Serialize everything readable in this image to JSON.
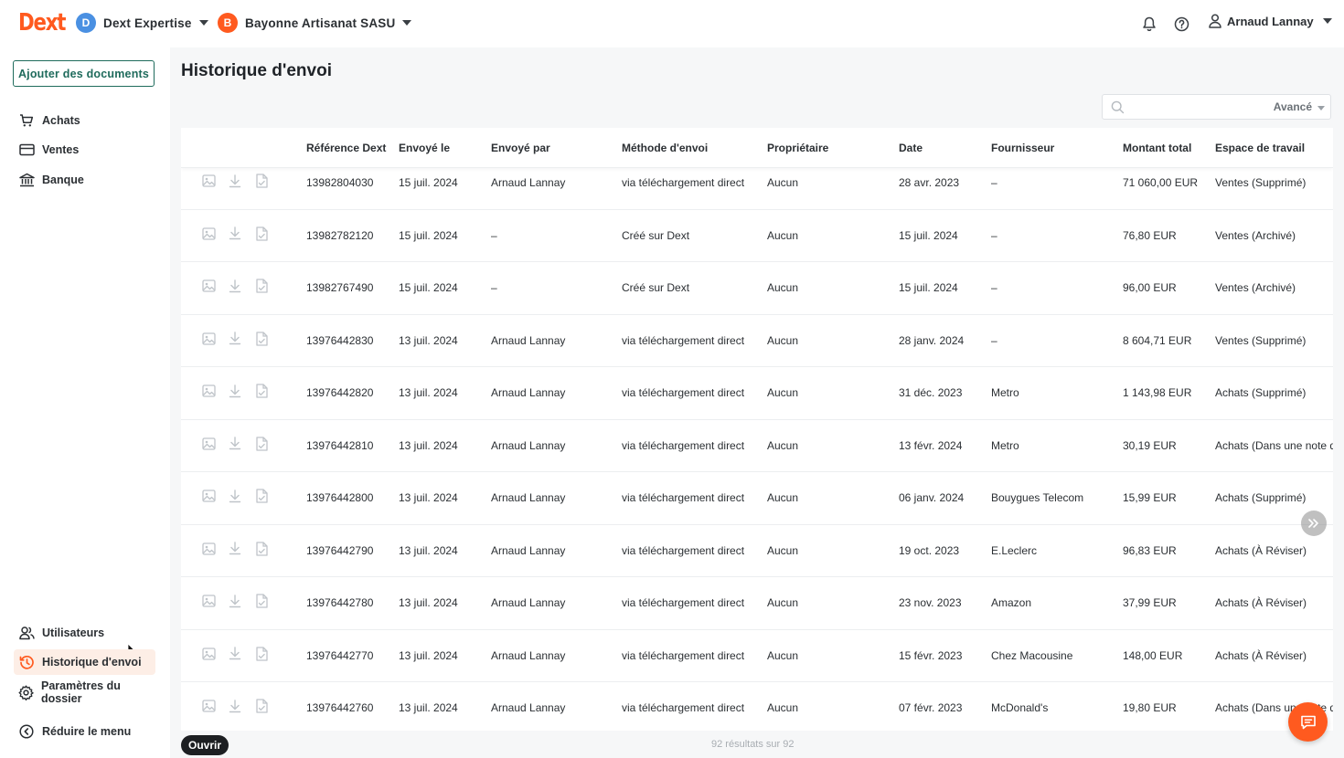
{
  "brand": {
    "logo_text": "Dext",
    "accent": "#ff5a1f"
  },
  "header": {
    "practice": {
      "initial": "D",
      "name": "Dext Expertise",
      "color": "#4a90e2"
    },
    "client": {
      "initial": "B",
      "name": "Bayonne Artisanat SASU",
      "color": "#ff5a1f"
    },
    "user_name": "Arnaud Lannay",
    "icons": [
      "bell-icon",
      "help-icon",
      "user-icon"
    ]
  },
  "sidebar": {
    "add_button": "Ajouter des documents",
    "top_items": [
      {
        "label": "Achats",
        "icon": "cart-icon"
      },
      {
        "label": "Ventes",
        "icon": "card-icon"
      },
      {
        "label": "Banque",
        "icon": "bank-icon"
      }
    ],
    "bottom_items": [
      {
        "label": "Utilisateurs",
        "icon": "users-icon"
      },
      {
        "label": "Historique d'envoi",
        "icon": "history-icon",
        "active": true
      },
      {
        "label": "Paramètres du dossier",
        "icon": "gear-icon"
      },
      {
        "label": "Réduire le menu",
        "icon": "collapse-icon"
      }
    ]
  },
  "main": {
    "title": "Historique d'envoi",
    "search": {
      "placeholder": "",
      "advanced_label": "Avancé"
    },
    "columns": [
      "Référence Dext",
      "Envoyé le",
      "Envoyé par",
      "Méthode d'envoi",
      "Propriétaire",
      "Date",
      "Fournisseur",
      "Montant total",
      "Espace de travail"
    ],
    "rows": [
      [
        "13982804030",
        "15 juil. 2024",
        "Arnaud Lannay",
        "via téléchargement direct",
        "Aucun",
        "28 avr. 2023",
        "–",
        "71 060,00 EUR",
        "Ventes (Supprimé)"
      ],
      [
        "13982782120",
        "15 juil. 2024",
        "–",
        "Créé sur Dext",
        "Aucun",
        "15 juil. 2024",
        "–",
        "76,80 EUR",
        "Ventes (Archivé)"
      ],
      [
        "13982767490",
        "15 juil. 2024",
        "–",
        "Créé sur Dext",
        "Aucun",
        "15 juil. 2024",
        "–",
        "96,00 EUR",
        "Ventes (Archivé)"
      ],
      [
        "13976442830",
        "13 juil. 2024",
        "Arnaud Lannay",
        "via téléchargement direct",
        "Aucun",
        "28 janv. 2024",
        "–",
        "8 604,71 EUR",
        "Ventes (Supprimé)"
      ],
      [
        "13976442820",
        "13 juil. 2024",
        "Arnaud Lannay",
        "via téléchargement direct",
        "Aucun",
        "31 déc. 2023",
        "Metro",
        "1 143,98 EUR",
        "Achats (Supprimé)"
      ],
      [
        "13976442810",
        "13 juil. 2024",
        "Arnaud Lannay",
        "via téléchargement direct",
        "Aucun",
        "13 févr. 2024",
        "Metro",
        "30,19 EUR",
        "Achats (Dans une note d"
      ],
      [
        "13976442800",
        "13 juil. 2024",
        "Arnaud Lannay",
        "via téléchargement direct",
        "Aucun",
        "06 janv. 2024",
        "Bouygues Telecom",
        "15,99 EUR",
        "Achats (Supprimé)"
      ],
      [
        "13976442790",
        "13 juil. 2024",
        "Arnaud Lannay",
        "via téléchargement direct",
        "Aucun",
        "19 oct. 2023",
        "E.Leclerc",
        "96,83 EUR",
        "Achats (À Réviser)"
      ],
      [
        "13976442780",
        "13 juil. 2024",
        "Arnaud Lannay",
        "via téléchargement direct",
        "Aucun",
        "23 nov. 2023",
        "Amazon",
        "37,99 EUR",
        "Achats (À Réviser)"
      ],
      [
        "13976442770",
        "13 juil. 2024",
        "Arnaud Lannay",
        "via téléchargement direct",
        "Aucun",
        "15 févr. 2023",
        "Chez Macousine",
        "148,00 EUR",
        "Achats (À Réviser)"
      ],
      [
        "13976442760",
        "13 juil. 2024",
        "Arnaud Lannay",
        "via téléchargement direct",
        "Aucun",
        "07 févr. 2023",
        "McDonald's",
        "19,80 EUR",
        "Achats (Dans une note d"
      ]
    ],
    "results_text": "92 résultats sur 92",
    "open_button": "Ouvrir"
  }
}
